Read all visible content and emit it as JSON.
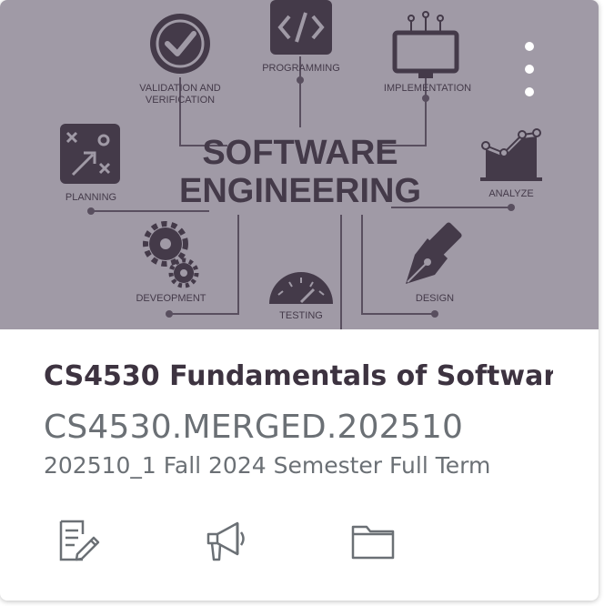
{
  "hero": {
    "center_line1": "SOFTWARE",
    "center_line2": "ENGINEERING",
    "labels": {
      "programming": "PROGRAMMING",
      "validation_line1": "VALIDATION AND",
      "validation_line2": "VERIFICATION",
      "implementation": "IMPLEMENTATION",
      "planning": "PLANNING",
      "analyze": "ANALYZE",
      "development": "DEVEOPMENT",
      "testing": "TESTING",
      "design": "DESIGN"
    },
    "icons": [
      "checkmark-circle-icon",
      "code-icon",
      "monitor-icon",
      "strategy-icon",
      "line-chart-icon",
      "gears-icon",
      "gauge-icon",
      "pen-nib-icon"
    ]
  },
  "menu": {
    "icon": "kebab-menu-icon"
  },
  "course": {
    "title": "CS4530 Fundamentals of Softwar",
    "title_ellipsis": "...",
    "code": "CS4530.MERGED.202510",
    "term": "202510_1 Fall 2024 Semester Full Term"
  },
  "actions": [
    {
      "icon": "assignments-icon"
    },
    {
      "icon": "announcements-icon"
    },
    {
      "icon": "files-icon"
    }
  ],
  "colors": {
    "hero_bg": "#b7b2bc",
    "hero_ink": "#403845",
    "title": "#3d3340",
    "ellipsis": "#9e2a2b",
    "muted_text": "#6b7075"
  }
}
